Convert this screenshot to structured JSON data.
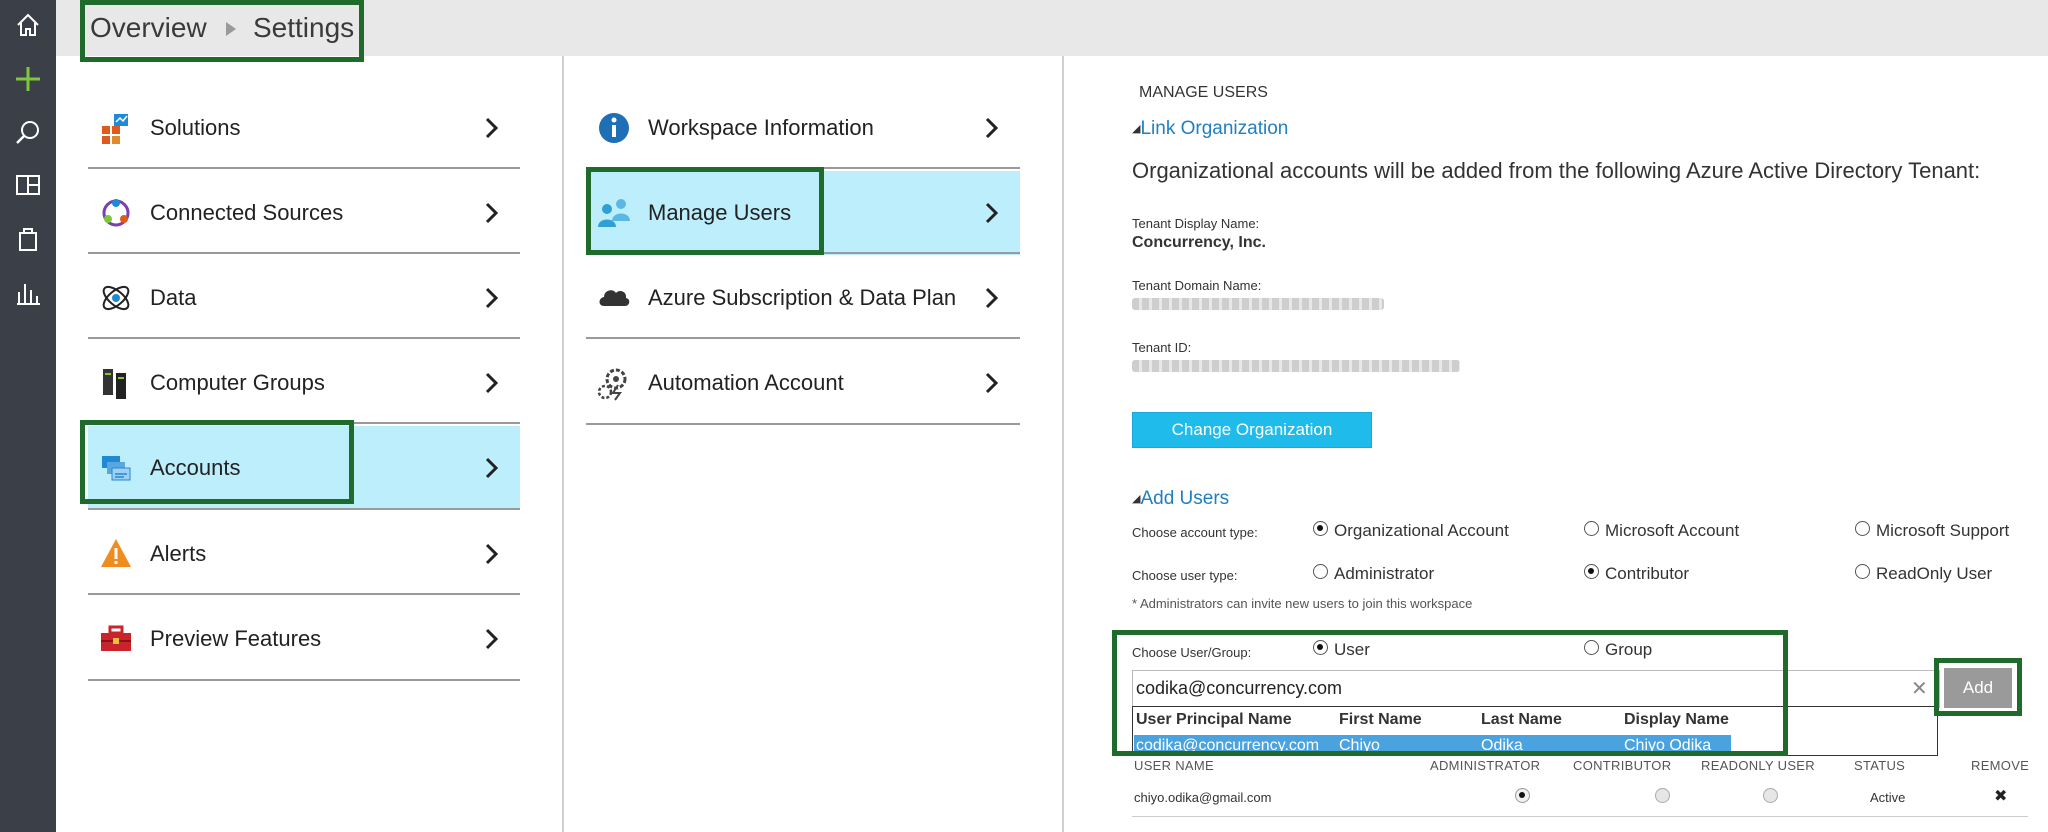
{
  "breadcrumb": {
    "overview": "Overview",
    "settings": "Settings"
  },
  "column1": {
    "items": [
      {
        "label": "Solutions",
        "icon": "solutions-icon"
      },
      {
        "label": "Connected Sources",
        "icon": "connected-sources-icon"
      },
      {
        "label": "Data",
        "icon": "data-icon"
      },
      {
        "label": "Computer Groups",
        "icon": "computer-groups-icon"
      },
      {
        "label": "Accounts",
        "icon": "accounts-icon",
        "selected": true
      },
      {
        "label": "Alerts",
        "icon": "alert-icon"
      },
      {
        "label": "Preview Features",
        "icon": "toolbox-icon"
      }
    ]
  },
  "column2": {
    "items": [
      {
        "label": "Workspace Information",
        "icon": "info-icon"
      },
      {
        "label": "Manage Users",
        "icon": "users-icon",
        "selected": true
      },
      {
        "label": "Azure Subscription & Data Plan",
        "icon": "cloud-icon"
      },
      {
        "label": "Automation Account",
        "icon": "automation-icon"
      }
    ]
  },
  "manage": {
    "section_title": "MANAGE USERS",
    "link_org": "Link Organization",
    "org_text": "Organizational accounts will be added from the following Azure Active Directory Tenant:",
    "tenant_display_label": "Tenant Display Name:",
    "tenant_display_value": "Concurrency, Inc.",
    "tenant_domain_label": "Tenant Domain Name:",
    "tenant_id_label": "Tenant ID:",
    "change_org_button": "Change Organization",
    "add_users": "Add Users",
    "account_type_label": "Choose account type:",
    "account_types": [
      "Organizational Account",
      "Microsoft Account",
      "Microsoft Support"
    ],
    "account_type_selected": 0,
    "user_type_label": "Choose user type:",
    "user_types": [
      "Administrator",
      "Contributor",
      "ReadOnly User"
    ],
    "user_type_selected": 1,
    "admin_note": "* Administrators can invite new users to join this workspace",
    "user_group_label": "Choose User/Group:",
    "user_group_options": [
      "User",
      "Group"
    ],
    "user_group_selected": 0,
    "search_value": "codika@concurrency.com",
    "clear_glyph": "✕",
    "add_button": "Add",
    "dropdown": {
      "headers": [
        "User Principal Name",
        "First Name",
        "Last Name",
        "Display Name"
      ],
      "row": [
        "codika@concurrency.com",
        "Chiyo",
        "Odika",
        "Chiyo Odika"
      ]
    },
    "table": {
      "headers": [
        "USER NAME",
        "ADMINISTRATOR",
        "CONTRIBUTOR",
        "READONLY USER",
        "STATUS",
        "REMOVE"
      ],
      "rows": [
        {
          "user": "chiyo.odika@gmail.com",
          "role_selected": 0,
          "status": "Active",
          "remove_glyph": "✖"
        }
      ]
    }
  },
  "colors": {
    "accent": "#1ebbeb",
    "highlight": "#bdeefc",
    "annotation": "#1f6b2c",
    "rail": "#3b3f47"
  }
}
